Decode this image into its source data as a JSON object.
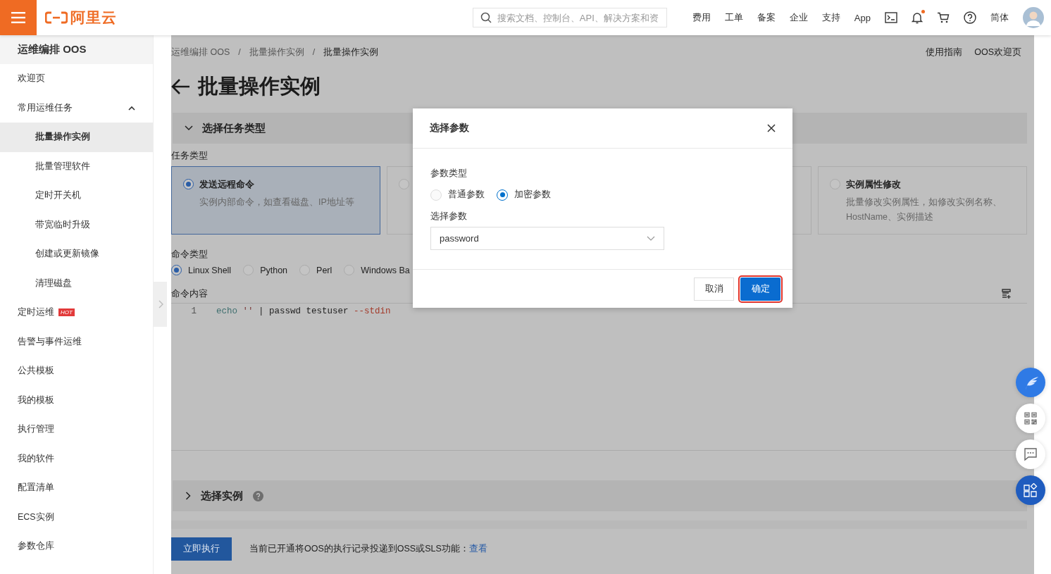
{
  "header": {
    "logo": "阿里云",
    "search": {
      "placeholder": "搜索文档、控制台、API、解决方案和资"
    },
    "nav": [
      "费用",
      "工单",
      "备案",
      "企业",
      "支持",
      "App"
    ],
    "language": "简体",
    "notification_dot": true
  },
  "sidebar": {
    "title": "运维编排 OOS",
    "items": [
      {
        "label": "欢迎页",
        "selected": false
      },
      {
        "label": "常用运维任务",
        "selected": false,
        "expanded": true,
        "children": [
          {
            "label": "批量操作实例",
            "selected": true
          },
          {
            "label": "批量管理软件",
            "selected": false
          },
          {
            "label": "定时开关机",
            "selected": false
          },
          {
            "label": "带宽临时升级",
            "selected": false
          },
          {
            "label": "创建或更新镜像",
            "selected": false
          },
          {
            "label": "清理磁盘",
            "selected": false
          }
        ]
      },
      {
        "label": "定时运维",
        "selected": false,
        "badge": "HOT"
      },
      {
        "label": "告警与事件运维",
        "selected": false
      },
      {
        "label": "公共模板",
        "selected": false
      },
      {
        "label": "我的模板",
        "selected": false
      },
      {
        "label": "执行管理",
        "selected": false
      },
      {
        "label": "我的软件",
        "selected": false
      },
      {
        "label": "配置清单",
        "selected": false
      },
      {
        "label": "ECS实例",
        "selected": false
      },
      {
        "label": "参数仓库",
        "selected": false
      }
    ]
  },
  "breadcrumb": [
    "运维编排 OOS",
    "批量操作实例",
    "批量操作实例"
  ],
  "breadcrumb_separator": "/",
  "top_links": [
    "使用指南",
    "OOS欢迎页"
  ],
  "page_title": "批量操作实例",
  "task_section": {
    "title": "选择任务类型",
    "expanded": true,
    "label": "任务类型",
    "cards": [
      {
        "kind": "option",
        "title": "发送远程命令",
        "description": "实例内部命令，如查看磁盘、IP地址等",
        "selected": true
      },
      {
        "kind": "option",
        "selected": false
      },
      {
        "kind": "covered"
      },
      {
        "kind": "option",
        "title": "实例属性修改",
        "description": "批量修改实例属性，如修改实例名称、HostName、实例描述",
        "selected": false
      }
    ]
  },
  "command_type": {
    "label": "命令类型",
    "options": [
      {
        "label": "Linux Shell",
        "selected": true
      },
      {
        "label": "Python",
        "selected": false
      },
      {
        "label": "Perl",
        "selected": false
      },
      {
        "label": "Windows Ba",
        "selected": false
      }
    ]
  },
  "command_content": {
    "label": "命令内容",
    "lines": [
      {
        "number": "1",
        "tokens": [
          {
            "text": "echo",
            "kind": "keyword"
          },
          {
            "text": " ''",
            "kind": "string"
          },
          {
            "text": " | passwd testuser ",
            "kind": "plain"
          },
          {
            "text": "--stdin",
            "kind": "flag"
          }
        ]
      }
    ]
  },
  "instance_section": {
    "title": "选择实例",
    "expanded": false
  },
  "footer": {
    "run_button": "立即执行",
    "notice": "当前已开通将OOS的执行记录投递到OSS或SLS功能：",
    "link": "查看"
  },
  "dialog": {
    "title": "选择参数",
    "param_type_label": "参数类型",
    "param_types": [
      {
        "label": "普通参数",
        "selected": false
      },
      {
        "label": "加密参数",
        "selected": true
      }
    ],
    "select_label": "选择参数",
    "select_value": "password",
    "cancel": "取消",
    "confirm": "确定"
  }
}
